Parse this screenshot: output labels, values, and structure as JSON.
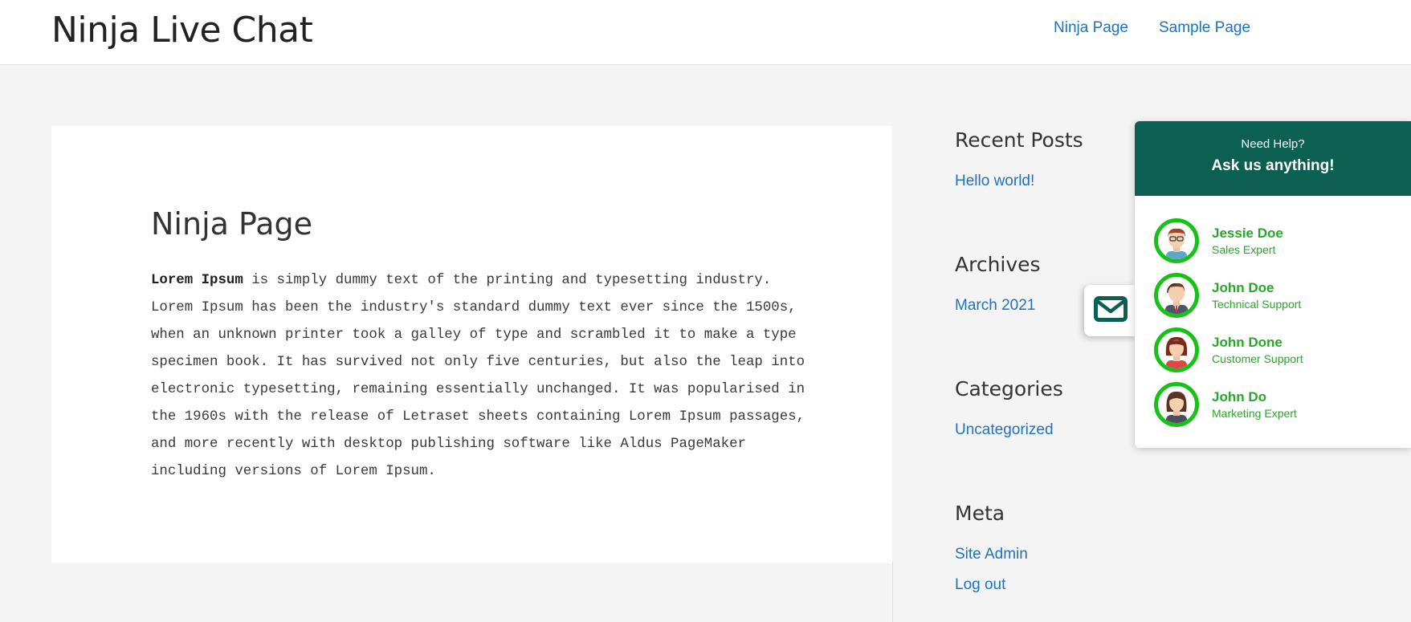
{
  "site": {
    "title": "Ninja Live Chat",
    "nav": [
      "Ninja Page",
      "Sample Page"
    ]
  },
  "entry": {
    "title": "Ninja Page",
    "bold_lead": "Lorem Ipsum",
    "body": " is simply dummy text of the printing and typesetting industry. Lorem Ipsum has been the industry's standard dummy text ever since the 1500s, when an unknown printer took a galley of type and scrambled it to make a type specimen book. It has survived not only five centuries, but also the leap into electronic typesetting, remaining essentially unchanged. It was popularised in the 1960s with the release of Letraset sheets containing Lorem Ipsum passages, and more recently with desktop publishing software like Aldus PageMaker including versions of Lorem Ipsum."
  },
  "sidebar": {
    "recent_posts": {
      "title": "Recent Posts",
      "items": [
        "Hello world!"
      ]
    },
    "archives": {
      "title": "Archives",
      "items": [
        "March 2021"
      ]
    },
    "categories": {
      "title": "Categories",
      "items": [
        "Uncategorized"
      ]
    },
    "meta": {
      "title": "Meta",
      "items": [
        "Site Admin",
        "Log out"
      ]
    }
  },
  "chat": {
    "need_help": "Need Help?",
    "ask": "Ask us anything!",
    "agents": [
      {
        "name": "Jessie Doe",
        "role": "Sales Expert"
      },
      {
        "name": "John Doe",
        "role": "Technical Support"
      },
      {
        "name": "John Done",
        "role": "Customer Support"
      },
      {
        "name": "John Do",
        "role": "Marketing Expert"
      }
    ],
    "mail_icon": "envelope-icon"
  },
  "colors": {
    "link": "#1e73be",
    "chat_header": "#0b6052",
    "agent_green": "#27a827",
    "avatar_ring": "#17c117"
  }
}
